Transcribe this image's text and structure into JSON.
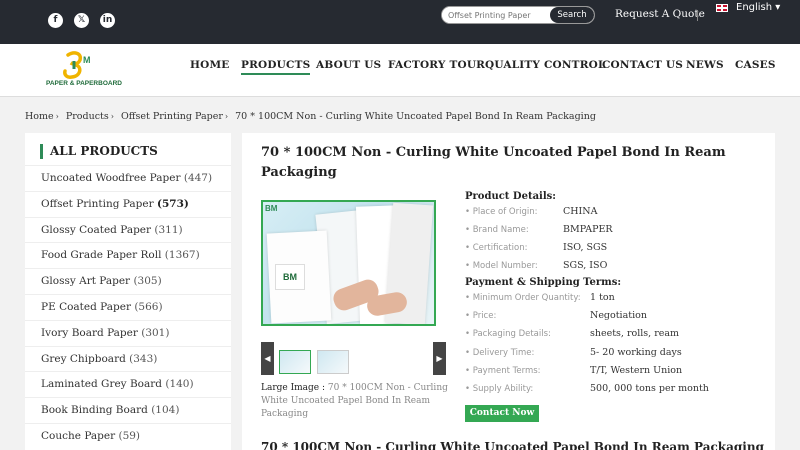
{
  "topbar": {
    "social": [
      {
        "name": "facebook",
        "glyph": "f"
      },
      {
        "name": "x",
        "glyph": "𝕏"
      },
      {
        "name": "linkedin",
        "glyph": "in"
      }
    ],
    "search_placeholder": "Offset Printing Paper",
    "search_button": "Search",
    "request_quote": "Request A Quote",
    "language": "English ▾"
  },
  "header": {
    "logo_text": "PAPER & PAPERBOARD",
    "nav": [
      "HOME",
      "PRODUCTS",
      "ABOUT US",
      "FACTORY TOUR",
      "QUALITY CONTROL",
      "CONTACT US",
      "NEWS",
      "CASES"
    ],
    "active_nav": "PRODUCTS"
  },
  "breadcrumb": [
    "Home",
    "Products",
    "Offset Printing Paper",
    "70 * 100CM Non - Curling White Uncoated Papel Bond In Ream Packaging"
  ],
  "sidebar": {
    "title": "ALL PRODUCTS",
    "items": [
      {
        "label": "Uncoated Woodfree Paper",
        "count": "(447)",
        "bold": false
      },
      {
        "label": "Offset Printing Paper",
        "count": "(573)",
        "bold": true
      },
      {
        "label": "Glossy Coated Paper",
        "count": "(311)",
        "bold": false
      },
      {
        "label": "Food Grade Paper Roll",
        "count": "(1367)",
        "bold": false
      },
      {
        "label": "Glossy Art Paper",
        "count": "(305)",
        "bold": false
      },
      {
        "label": "PE Coated Paper",
        "count": "(566)",
        "bold": false
      },
      {
        "label": "Ivory Board Paper",
        "count": "(301)",
        "bold": false
      },
      {
        "label": "Grey Chipboard",
        "count": "(343)",
        "bold": false
      },
      {
        "label": "Laminated Grey Board",
        "count": "(140)",
        "bold": false
      },
      {
        "label": "Book Binding Board",
        "count": "(104)",
        "bold": false
      },
      {
        "label": "Couche Paper",
        "count": "(59)",
        "bold": false
      }
    ]
  },
  "product": {
    "title": "70 * 100CM Non - Curling White Uncoated Papel Bond In Ream Packaging",
    "image_logo": "BM",
    "caption_label": "Large Image :",
    "caption_value": "70 * 100CM Non - Curling White Uncoated Papel Bond In Ream Packaging",
    "details_title": "Product Details:",
    "details": [
      {
        "label": "Place of Origin:",
        "value": "CHINA"
      },
      {
        "label": "Brand Name:",
        "value": "BMPAPER"
      },
      {
        "label": "Certification:",
        "value": "ISO, SGS"
      },
      {
        "label": "Model Number:",
        "value": "SGS, ISO"
      }
    ],
    "terms_title": "Payment & Shipping Terms:",
    "terms": [
      {
        "label": "Minimum Order Quantity:",
        "value": "1 ton"
      },
      {
        "label": "Price:",
        "value": "Negotiation"
      },
      {
        "label": "Packaging Details:",
        "value": "sheets, rolls, ream"
      },
      {
        "label": "Delivery Time:",
        "value": "5- 20 working days"
      },
      {
        "label": "Payment Terms:",
        "value": "T/T, Western Union"
      },
      {
        "label": "Supply Ability:",
        "value": "500, 000 tons per month"
      }
    ],
    "contact_button": "Contact Now",
    "bottom_title": "70 * 100CM Non - Curling White Uncoated Papel Bond In Ream Packaging"
  }
}
